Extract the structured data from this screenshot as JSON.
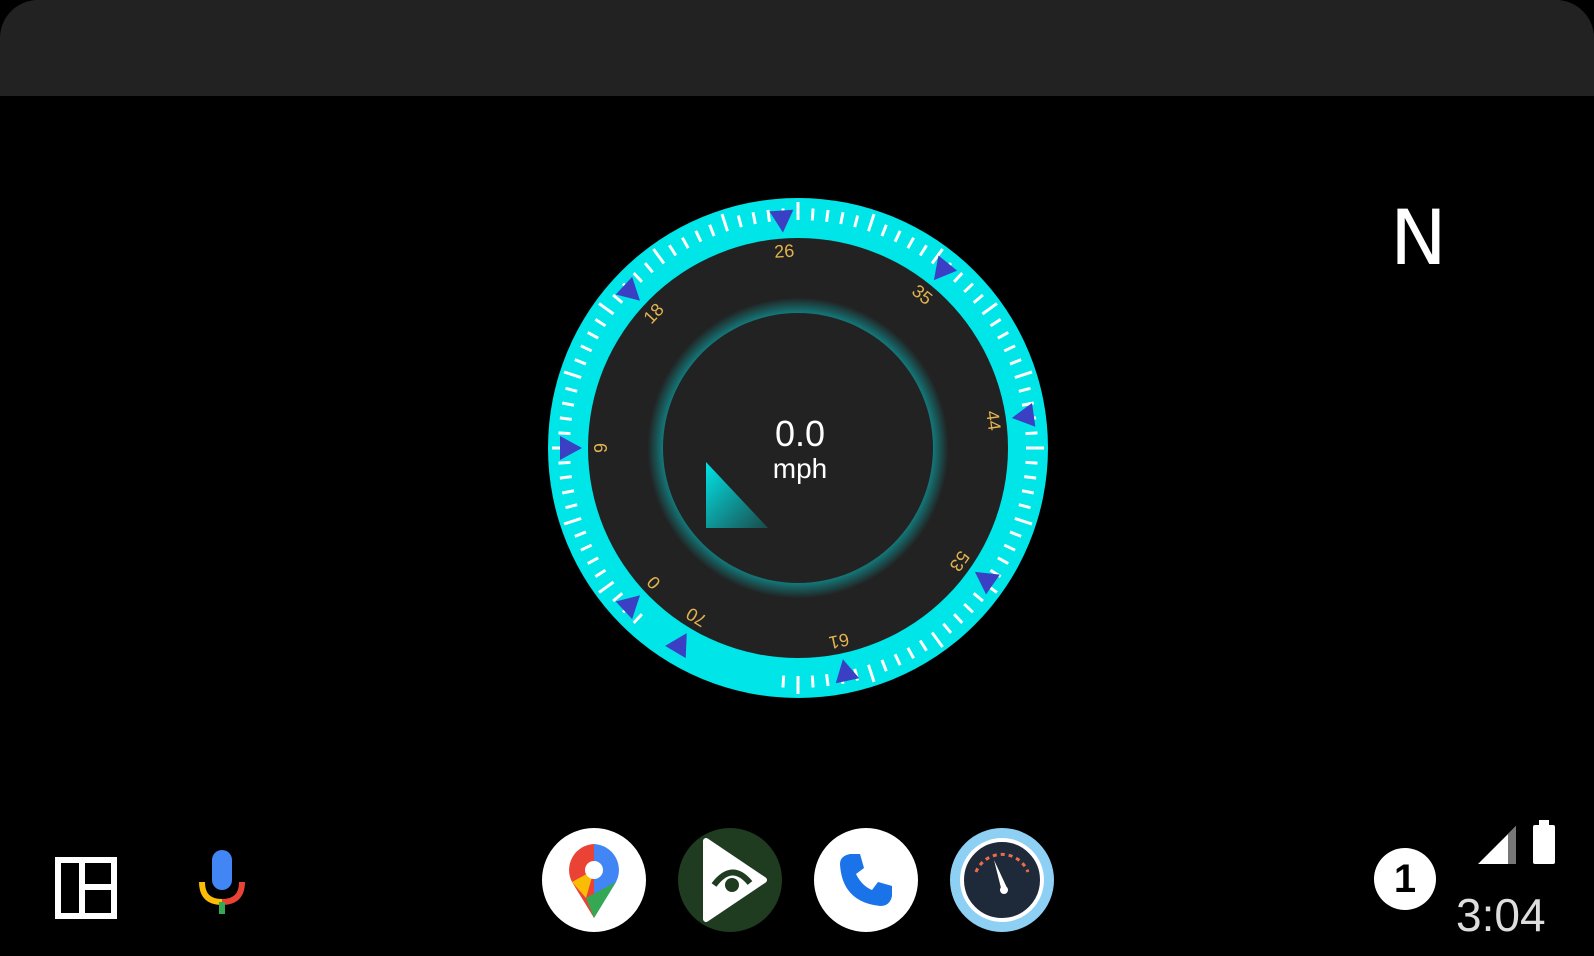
{
  "compass": {
    "heading": "N"
  },
  "speedometer": {
    "value": "0.0",
    "unit": "mph",
    "tick_labels": [
      "0",
      "9",
      "18",
      "26",
      "35",
      "44",
      "53",
      "61",
      "70"
    ]
  },
  "status": {
    "notification_count": "1",
    "time": "3:04"
  },
  "apps": [
    {
      "name": "Google Maps",
      "icon": "maps-pin-icon"
    },
    {
      "name": "Play",
      "icon": "play-eye-icon"
    },
    {
      "name": "Phone",
      "icon": "phone-icon"
    },
    {
      "name": "Speedometer",
      "icon": "speedometer-icon"
    }
  ],
  "colors": {
    "accent_cyan": "#00e5e8",
    "tick_label": "#e2b350",
    "marker_blue": "#3a3fc4",
    "top_bar": "#222222",
    "gauge_face": "#222222"
  }
}
